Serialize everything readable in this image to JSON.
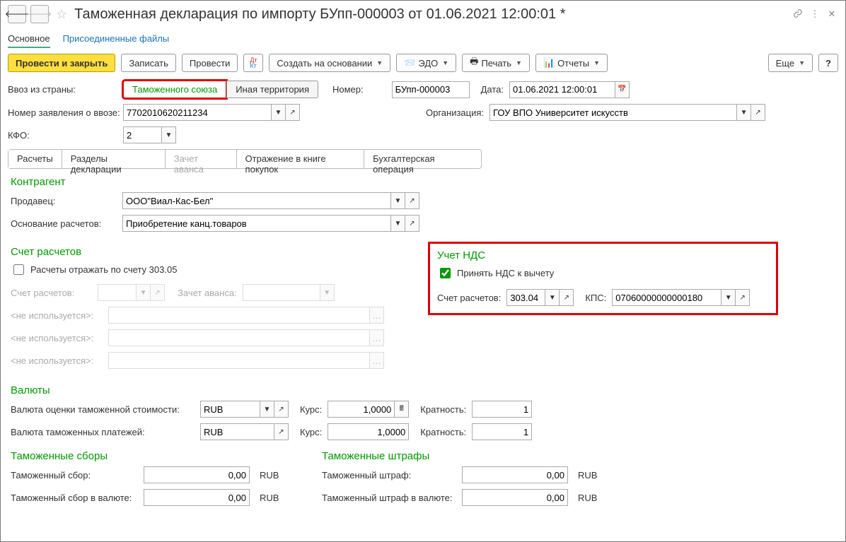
{
  "header": {
    "title": "Таможенная декларация по импорту БУпп-000003 от 01.06.2021 12:00:01 *"
  },
  "topnav": {
    "main": "Основное",
    "files": "Присоединенные файлы"
  },
  "cmd": {
    "post_close": "Провести и закрыть",
    "write": "Записать",
    "post": "Провести",
    "create_based": "Создать на основании",
    "edo": "ЭДО",
    "print": "Печать",
    "reports": "Отчеты",
    "more": "Еще"
  },
  "import": {
    "from_label": "Ввоз из страны:",
    "union": "Таможенного союза",
    "other": "Иная территория",
    "num_label": "Номер:",
    "num": "БУпп-000003",
    "date_label": "Дата:",
    "date": "01.06.2021 12:00:01",
    "decl_num_label": "Номер заявления о ввозе:",
    "decl_num": "7702010620211234",
    "org_label": "Организация:",
    "org": "ГОУ ВПО Университет искусств",
    "kfo_label": "КФО:",
    "kfo": "2"
  },
  "tabs": {
    "calc": "Расчеты",
    "sections": "Разделы декларации",
    "advance": "Зачет аванса",
    "book": "Отражение в книге покупок",
    "buh": "Бухгалтерская операция"
  },
  "counterparty": {
    "heading": "Контрагент",
    "seller_label": "Продавец:",
    "seller": "ООО\"Виал-Кас-Бел\"",
    "basis_label": "Основание расчетов:",
    "basis": "Приобретение канц.товаров"
  },
  "acct": {
    "heading": "Счет расчетов",
    "chk_label": "Расчеты отражать по счету 303.05",
    "acct_label": "Счет расчетов:",
    "advance_label": "Зачет аванса:",
    "unused": "<не используется>:"
  },
  "vat": {
    "heading": "Учет НДС",
    "chk_label": "Принять НДС к вычету",
    "acct_label": "Счет расчетов:",
    "acct": "303.04",
    "kps_label": "КПС:",
    "kps": "07060000000000180"
  },
  "currencies": {
    "heading": "Валюты",
    "eval_label": "Валюта оценки таможенной стоимости:",
    "eval_cur": "RUB",
    "rate_label": "Курс:",
    "rate1": "1,0000",
    "mult_label": "Кратность:",
    "mult1": "1",
    "pay_label": "Валюта таможенных платежей:",
    "pay_cur": "RUB",
    "rate2": "1,0000",
    "mult2": "1"
  },
  "fees": {
    "heading": "Таможенные сборы",
    "fee_label": "Таможенный сбор:",
    "fee": "0,00",
    "fee_cur_label": "Таможенный сбор в валюте:",
    "fee_cur": "0,00",
    "rub": "RUB"
  },
  "fines": {
    "heading": "Таможенные штрафы",
    "fine_label": "Таможенный штраф:",
    "fine": "0,00",
    "fine_cur_label": "Таможенный штраф в валюте:",
    "fine_cur": "0,00",
    "rub": "RUB"
  }
}
